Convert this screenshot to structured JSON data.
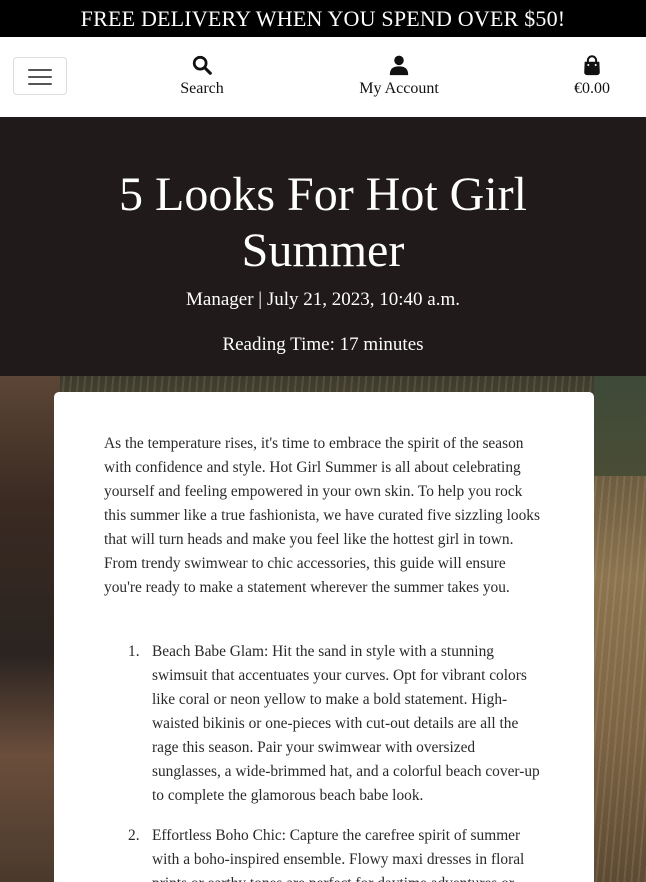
{
  "promo": {
    "text": "FREE DELIVERY WHEN YOU SPEND OVER $50!"
  },
  "nav": {
    "search_label": "Search",
    "account_label": "My Account",
    "cart_total": "€0.00"
  },
  "post": {
    "title": "5 Looks For Hot Girl Summer",
    "meta": "Manager | July 21, 2023, 10:40 a.m.",
    "reading_time": "Reading Time: 17 minutes",
    "intro": "As the temperature rises, it's time to embrace the spirit of the season with confidence and style. Hot Girl Summer is all about celebrating yourself and feeling empowered in your own skin. To help you rock this summer like a true fashionista, we have curated five sizzling looks that will turn heads and make you feel like the hottest girl in town. From trendy swimwear to chic accessories, this guide will ensure you're ready to make a statement wherever the summer takes you.",
    "items": [
      {
        "num": "1.",
        "text": "Beach Babe Glam: Hit the sand in style with a stunning swimsuit that accentuates your curves. Opt for vibrant colors like coral or neon yellow to make a bold statement. High-waisted bikinis or one-pieces with cut-out details are all the rage this season. Pair your swimwear with oversized sunglasses, a wide-brimmed hat, and a colorful beach cover-up to complete the glamorous beach babe look."
      },
      {
        "num": "2.",
        "text": "Effortless Boho Chic: Capture the carefree spirit of summer with a boho-inspired ensemble. Flowy maxi dresses in floral prints or earthy tones are perfect for daytime adventures or"
      }
    ]
  },
  "colors": {
    "hero_bg": "#201a1a",
    "promo_bg": "#000000"
  }
}
